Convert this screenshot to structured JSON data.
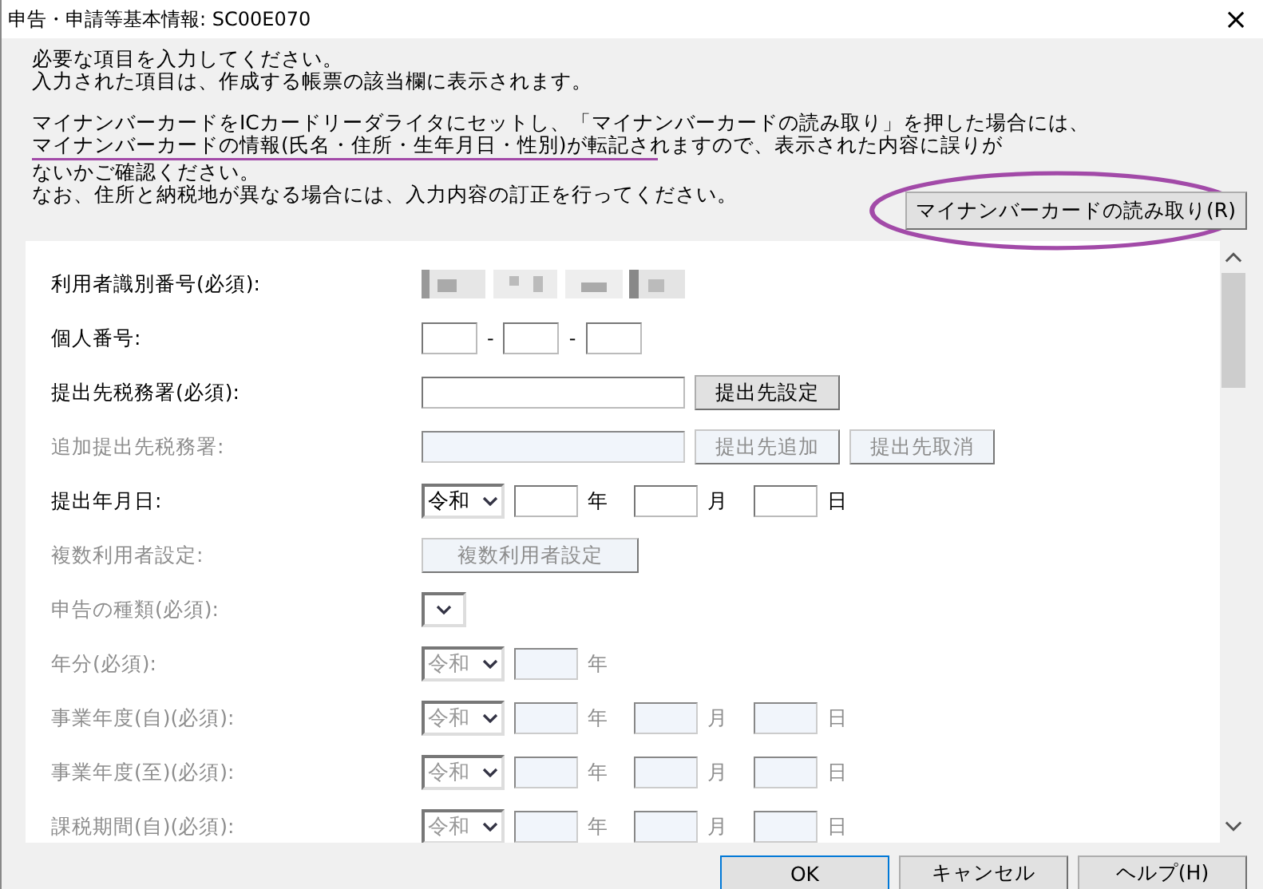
{
  "window": {
    "title": "申告・申請等基本情報: SC00E070",
    "close": "×"
  },
  "intro": [
    "必要な項目を入力してください。",
    "入力された項目は、作成する帳票の該当欄に表示されます。"
  ],
  "notice": [
    "マイナンバーカードをICカードリーダライタにセットし、「マイナンバーカードの読み取り」を押した場合には、",
    "マイナンバーカードの情報(氏名・住所・生年月日・性別)が転記されますので、表示された内容に誤りが",
    "ないかご確認ください。",
    "なお、住所と納税地が異なる場合には、入力内容の訂正を行ってください。"
  ],
  "read_button": "マイナンバーカードの読み取り(R)",
  "rows": [
    {
      "kind": "masked",
      "label": "利用者識別番号(必須):",
      "disabled": false
    },
    {
      "kind": "segments",
      "label": "個人番号:",
      "disabled": false,
      "separators": [
        "-",
        "-"
      ]
    },
    {
      "kind": "field_buttons",
      "label": "提出先税務署(必須):",
      "disabled": false,
      "buttons": [
        "提出先設定"
      ]
    },
    {
      "kind": "field_buttons",
      "label": "追加提出先税務署:",
      "disabled": true,
      "buttons": [
        "提出先追加",
        "提出先取消"
      ]
    },
    {
      "kind": "era_date",
      "label": "提出年月日:",
      "disabled": false,
      "era": "令和",
      "units": [
        "年",
        "月",
        "日"
      ]
    },
    {
      "kind": "button",
      "label": "複数利用者設定:",
      "disabled": true,
      "button": "複数利用者設定"
    },
    {
      "kind": "select",
      "label": "申告の種類(必須):",
      "disabled": true
    },
    {
      "kind": "era_date",
      "label": "年分(必須):",
      "disabled": true,
      "era": "令和",
      "units": [
        "年"
      ]
    },
    {
      "kind": "era_date",
      "label": "事業年度(自)(必須):",
      "disabled": true,
      "era": "令和",
      "units": [
        "年",
        "月",
        "日"
      ]
    },
    {
      "kind": "era_date",
      "label": "事業年度(至)(必須):",
      "disabled": true,
      "era": "令和",
      "units": [
        "年",
        "月",
        "日"
      ]
    },
    {
      "kind": "era_date",
      "label": "課税期間(自)(必須):",
      "disabled": true,
      "era": "令和",
      "units": [
        "年",
        "月",
        "日"
      ]
    }
  ],
  "buttons": [
    "OK",
    "キャンセル",
    "ヘルプ(H)"
  ]
}
